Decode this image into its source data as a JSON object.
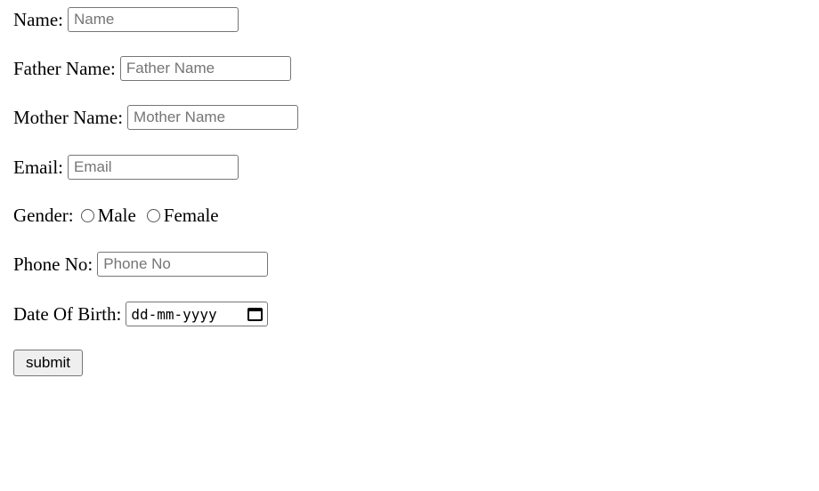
{
  "form": {
    "name": {
      "label": "Name:",
      "placeholder": "Name",
      "value": ""
    },
    "father_name": {
      "label": "Father Name:",
      "placeholder": "Father Name",
      "value": ""
    },
    "mother_name": {
      "label": "Mother Name:",
      "placeholder": "Mother Name",
      "value": ""
    },
    "email": {
      "label": "Email:",
      "placeholder": "Email",
      "value": ""
    },
    "gender": {
      "label": "Gender:",
      "options": [
        {
          "label": "Male",
          "checked": false
        },
        {
          "label": "Female",
          "checked": false
        }
      ]
    },
    "phone": {
      "label": "Phone No:",
      "placeholder": "Phone No",
      "value": ""
    },
    "dob": {
      "label": "Date Of Birth:",
      "placeholder": "dd-mm-yyyy",
      "icon": "calendar-icon"
    },
    "submit_label": "submit"
  }
}
